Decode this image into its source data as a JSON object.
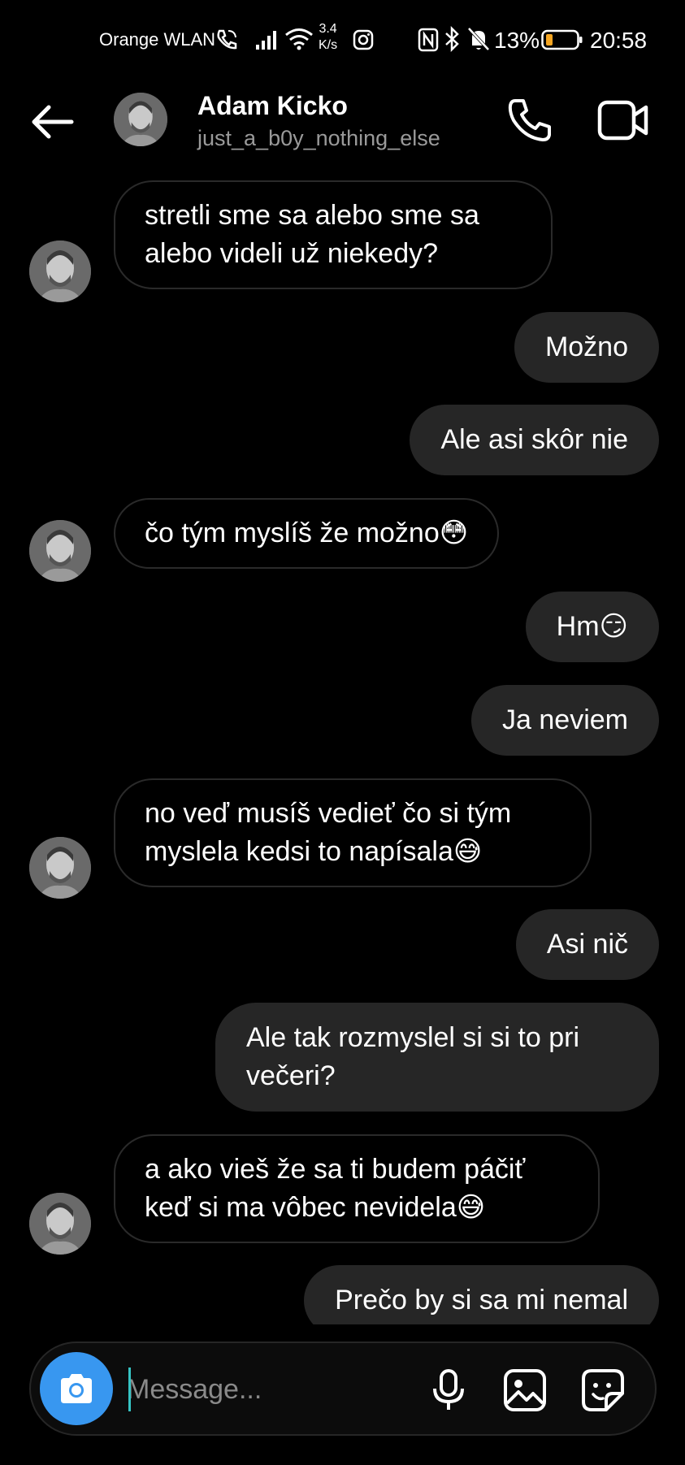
{
  "status_bar": {
    "carrier": "Orange WLAN",
    "speed_value": "3.4",
    "speed_unit": "K/s",
    "battery": "13%",
    "time": "20:58",
    "icons": [
      "wifi-call-icon",
      "signal-icon",
      "wifi-icon",
      "instagram-icon",
      "nfc-icon",
      "bluetooth-icon",
      "mute-icon",
      "battery-icon"
    ]
  },
  "header": {
    "name": "Adam Kicko",
    "username": "just_a_b0y_nothing_else",
    "icons": [
      "back-arrow-icon",
      "phone-icon",
      "video-icon"
    ]
  },
  "messages": [
    {
      "side": "in",
      "text": "stretli sme sa alebo sme sa alebo videli už niekedy?"
    },
    {
      "side": "out",
      "text": "Možno"
    },
    {
      "side": "out",
      "text": "Ale asi skôr nie"
    },
    {
      "side": "in",
      "text": "čo tým myslíš že možno😳"
    },
    {
      "side": "out",
      "text": "Hm😏"
    },
    {
      "side": "out",
      "text": "Ja neviem"
    },
    {
      "side": "in",
      "text": "no veď musíš vedieť čo si tým myslela kedsi to napísala😅"
    },
    {
      "side": "out",
      "text": "Asi nič"
    },
    {
      "side": "out",
      "text": "Ale tak rozmyslel si si to pri večeri?"
    },
    {
      "side": "in",
      "text": "a ako vieš že sa ti budem páčiť keď si ma vôbec nevidela😅"
    },
    {
      "side": "out",
      "text": "Prečo by si sa mi nemal"
    }
  ],
  "composer": {
    "placeholder": "Message...",
    "icons": [
      "camera-icon",
      "microphone-icon",
      "gallery-icon",
      "sticker-icon"
    ],
    "accent": "#3897f0"
  },
  "colors": {
    "background": "#000000",
    "outgoing_bubble": "#262626",
    "incoming_border": "#2a2a2a"
  }
}
